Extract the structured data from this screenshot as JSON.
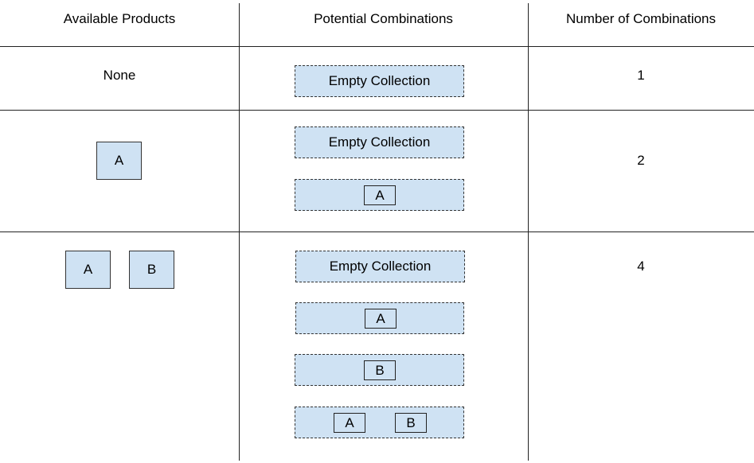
{
  "headers": [
    "Available Products",
    "Potential Combinations",
    "Number of Combinations"
  ],
  "rows": [
    {
      "available": {
        "text": "None",
        "items": []
      },
      "combinations": [
        {
          "label": "Empty Collection",
          "items": []
        }
      ],
      "count": "1"
    },
    {
      "available": {
        "items": [
          "A"
        ]
      },
      "combinations": [
        {
          "label": "Empty Collection",
          "items": []
        },
        {
          "items": [
            "A"
          ]
        }
      ],
      "count": "2"
    },
    {
      "available": {
        "items": [
          "A",
          "B"
        ]
      },
      "combinations": [
        {
          "label": "Empty Collection",
          "items": []
        },
        {
          "items": [
            "A"
          ]
        },
        {
          "items": [
            "B"
          ]
        },
        {
          "items": [
            "A",
            "B"
          ]
        }
      ],
      "count": "4"
    }
  ],
  "colors": {
    "box_fill": "#cfe2f3",
    "border": "#333333"
  }
}
